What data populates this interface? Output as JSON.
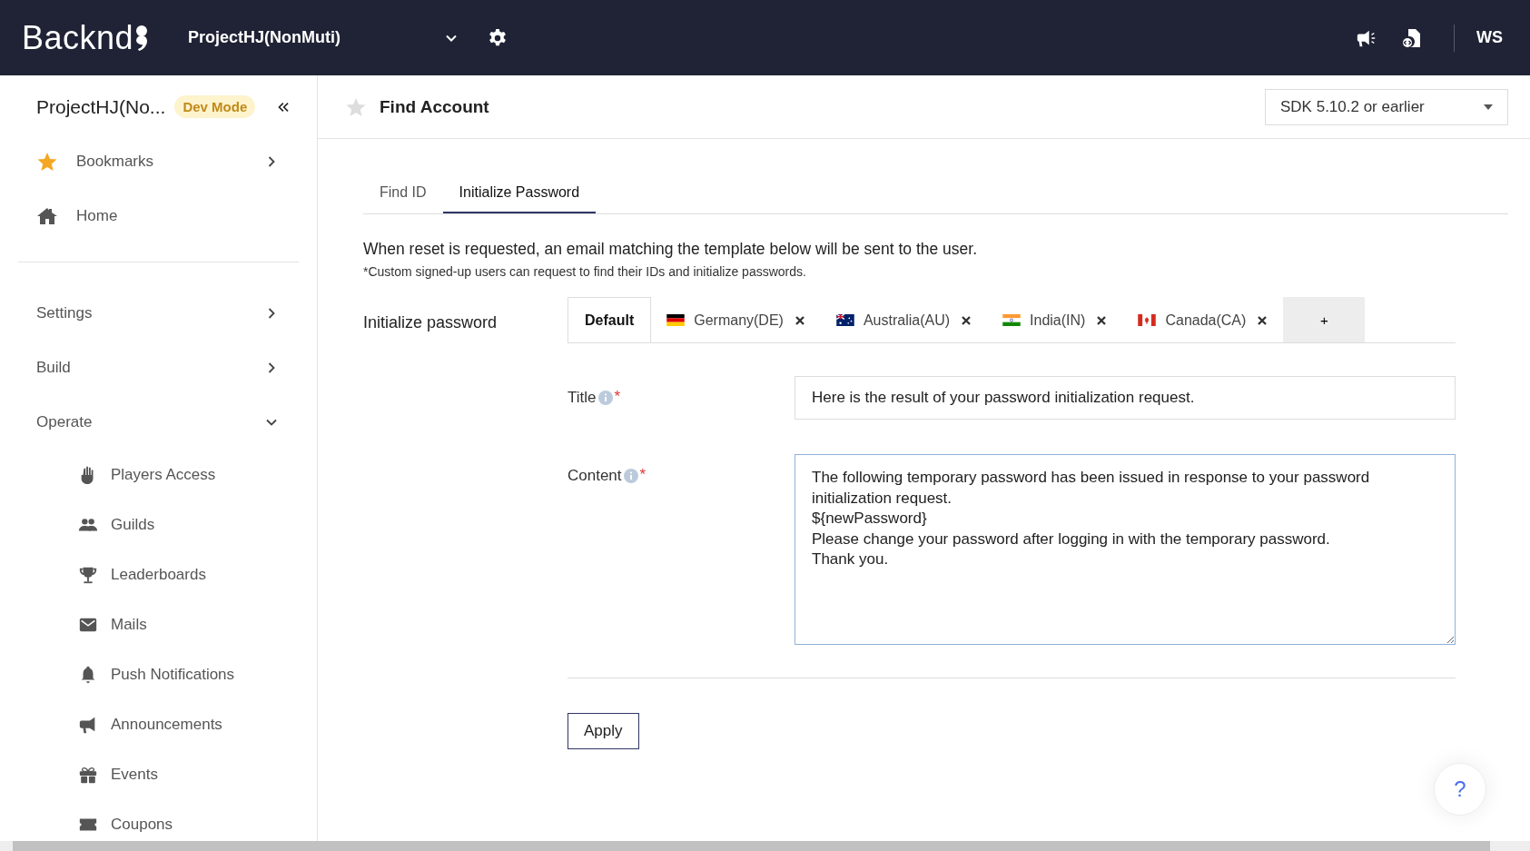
{
  "topbar": {
    "logo": "Backnd",
    "project": "ProjectHJ(NonMuti)",
    "user": "WS"
  },
  "sidebar": {
    "project": "ProjectHJ(No...",
    "badge": "Dev Mode",
    "top_items": [
      {
        "label": "Bookmarks"
      },
      {
        "label": "Home"
      }
    ],
    "groups": [
      {
        "label": "Settings",
        "expanded": false
      },
      {
        "label": "Build",
        "expanded": false
      },
      {
        "label": "Operate",
        "expanded": true,
        "children": [
          {
            "label": "Players Access"
          },
          {
            "label": "Guilds"
          },
          {
            "label": "Leaderboards"
          },
          {
            "label": "Mails"
          },
          {
            "label": "Push Notifications"
          },
          {
            "label": "Announcements"
          },
          {
            "label": "Events"
          },
          {
            "label": "Coupons"
          }
        ]
      }
    ]
  },
  "header": {
    "title": "Find Account",
    "bookmarked": false,
    "sdk": "SDK 5.10.2 or earlier"
  },
  "tabs": [
    {
      "label": "Find ID",
      "selected": false
    },
    {
      "label": "Initialize Password",
      "selected": true
    }
  ],
  "description": "When reset is requested, an email matching the template below will be sent to the user.",
  "note": "*Custom signed-up users can request to find their IDs and initialize passwords.",
  "section_label": "Initialize password",
  "languages": [
    {
      "label": "Default",
      "selected": true
    },
    {
      "label": "Germany(DE)",
      "selected": false
    },
    {
      "label": "Australia(AU)",
      "selected": false
    },
    {
      "label": "India(IN)",
      "selected": false
    },
    {
      "label": "Canada(CA)",
      "selected": false
    }
  ],
  "add_language": "+",
  "fields": [
    {
      "label": "Title",
      "required_mark": "*",
      "kind": "input",
      "value": "Here is the result of your password initialization request."
    },
    {
      "label": "Content",
      "required_mark": "*",
      "kind": "textarea",
      "value": "The following temporary password has been issued in response to your password initialization request.\n${newPassword}\nPlease change your password after logging in with the temporary password.\nThank you."
    }
  ],
  "apply": "Apply",
  "help": "?"
}
